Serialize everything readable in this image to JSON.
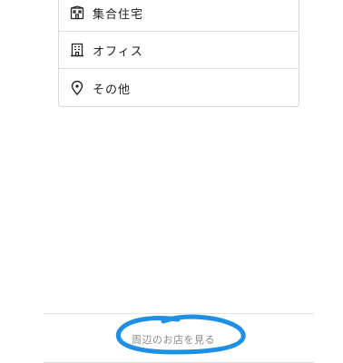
{
  "building_types": [
    {
      "label": "集合住宅",
      "icon": "apartment-building-icon"
    },
    {
      "label": "オフィス",
      "icon": "office-building-icon"
    },
    {
      "label": "その他",
      "icon": "location-pin-icon"
    }
  ],
  "footer": {
    "nearby_button_label": "周辺のお店を見る"
  },
  "colors": {
    "annotation_circle": "#1e8fe3",
    "button_text": "#8a8a8a",
    "divider": "#e3e3e3"
  }
}
